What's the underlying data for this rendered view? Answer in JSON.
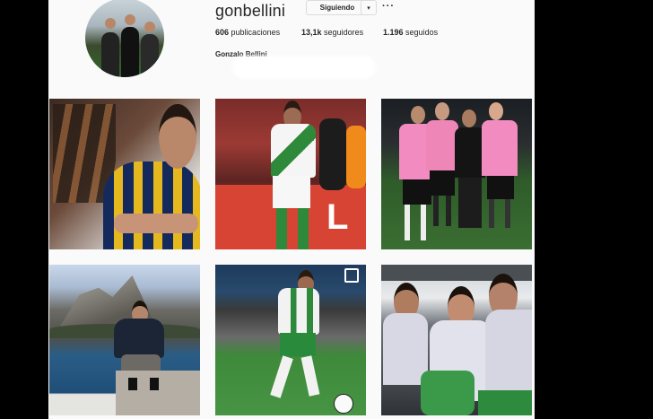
{
  "profile": {
    "username": "gonbellini",
    "follow_label": "Siguiendo",
    "caret": "▾",
    "more": "···",
    "full_name": "Gonzalo Bellini"
  },
  "stats": [
    {
      "count": "606",
      "label": "publicaciones"
    },
    {
      "count": "13,1k",
      "label": "seguidores"
    },
    {
      "count": "1.196",
      "label": "seguidos"
    }
  ],
  "posts": [
    {
      "icon": "player-rosario-central-photo"
    },
    {
      "icon": "player-banfield-celebration-photo"
    },
    {
      "icon": "group-pink-jerseys-photo"
    },
    {
      "icon": "lake-mountains-photo"
    },
    {
      "icon": "player-dribbling-ball-photo"
    },
    {
      "icon": "players-bus-selfie-photo"
    }
  ]
}
